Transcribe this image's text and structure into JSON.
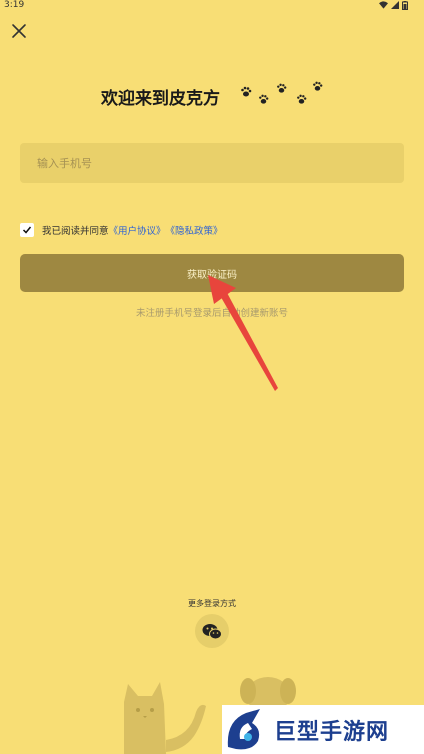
{
  "status_bar": {
    "time": "3:19"
  },
  "header": {
    "title": "欢迎来到皮克方"
  },
  "form": {
    "phone_placeholder": "输入手机号",
    "agree_text": "我已阅读并同意",
    "user_agreement": "《用户协议》",
    "privacy_policy": "《隐私政策》",
    "agreed": true,
    "get_code_label": "获取验证码",
    "hint": "未注册手机号登录后自动创建新账号"
  },
  "other_login": {
    "label": "更多登录方式",
    "wechat_icon": "wechat-icon"
  },
  "watermark": {
    "text": "巨型手游网"
  },
  "colors": {
    "background": "#f8de75",
    "input_bg": "#e9d06a",
    "button_bg": "#9e8841",
    "link": "#2f63d4",
    "arrow": "#e8453c"
  }
}
